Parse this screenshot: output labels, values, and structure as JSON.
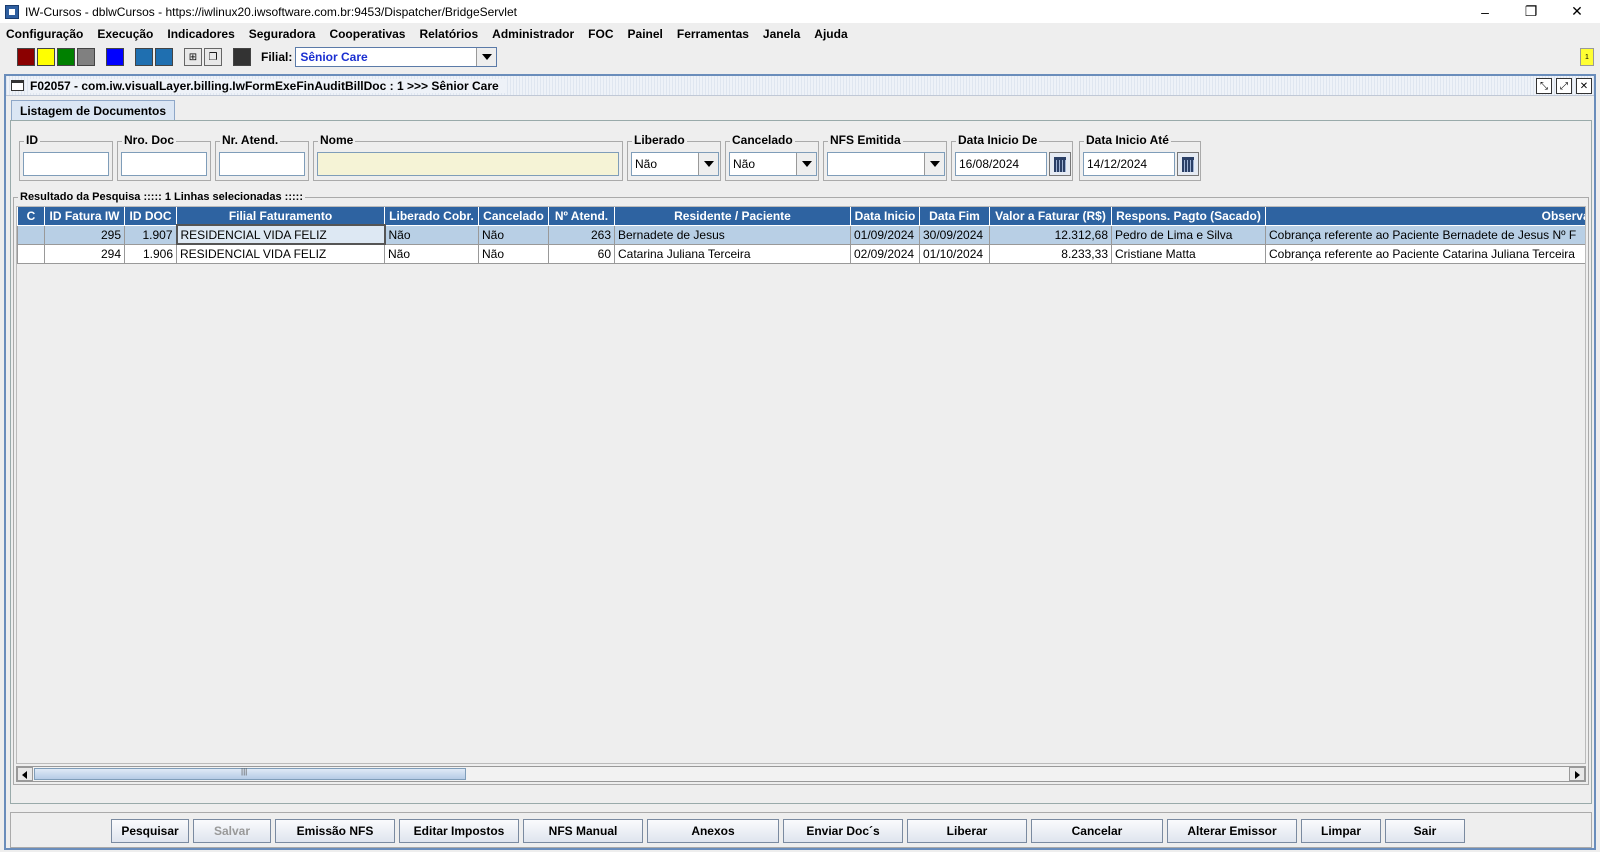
{
  "window": {
    "title": "IW-Cursos - dblwCursos - https://iwlinux20.iwsoftware.com.br:9453/Dispatcher/BridgeServlet",
    "min": "–",
    "restore": "❐",
    "close": "✕"
  },
  "menu": [
    "Configuração",
    "Execução",
    "Indicadores",
    "Seguradora",
    "Cooperativas",
    "Relatórios",
    "Administrador",
    "FOC",
    "Painel",
    "Ferramentas",
    "Janela",
    "Ajuda"
  ],
  "toolbar": {
    "swatches": [
      "#8b0000",
      "#ffff00",
      "#008000",
      "#808080",
      "#0000ff",
      "#1f6fb0",
      "#1f6fb0"
    ],
    "filial_label": "Filial:",
    "filial_value": "Sênior Care",
    "notif": "1"
  },
  "frame": {
    "title": "F02057 - com.iw.visualLayer.billing.IwFormExeFinAuditBillDoc : 1 >>> Sênior Care",
    "tab": "Listagem de Documentos"
  },
  "filters": {
    "id_label": "ID",
    "nrodoc_label": "Nro. Doc",
    "nratend_label": "Nr. Atend.",
    "nome_label": "Nome",
    "liberado_label": "Liberado",
    "liberado_value": "Não",
    "cancelado_label": "Cancelado",
    "cancelado_value": "Não",
    "nfs_label": "NFS Emitida",
    "nfs_value": "",
    "dtde_label": "Data Inicio De",
    "dtde_value": "16/08/2024",
    "dtate_label": "Data Inicio Até",
    "dtate_value": "14/12/2024"
  },
  "results": {
    "label": "Resultado da Pesquisa ::::: 1 Linhas selecionadas :::::",
    "columns": [
      "C",
      "ID Fatura IW",
      "ID DOC",
      "Filial Faturamento",
      "Liberado Cobr.",
      "Cancelado",
      "Nº Atend.",
      "Residente / Paciente",
      "Data Inicio",
      "Data Fim",
      "Valor a Faturar (R$)",
      "Respons. Pagto (Sacado)",
      "Observações"
    ],
    "rows": [
      [
        "",
        "295",
        "1.907",
        "RESIDENCIAL VIDA FELIZ",
        "Não",
        "Não",
        "263",
        "Bernadete de Jesus",
        "01/09/2024",
        "30/09/2024",
        "12.312,68",
        "Pedro de Lima e Silva",
        "Cobrança referente ao Paciente Bernadete de Jesus  Nº F"
      ],
      [
        "",
        "294",
        "1.906",
        "RESIDENCIAL VIDA FELIZ",
        "Não",
        "Não",
        "60",
        "Catarina Juliana Terceira",
        "02/09/2024",
        "01/10/2024",
        "8.233,33",
        "Cristiane Matta",
        "Cobrança referente ao Paciente Catarina Juliana Terceira"
      ]
    ]
  },
  "buttons": {
    "pesquisar": "Pesquisar",
    "salvar": "Salvar",
    "emissao_nfs": "Emissão NFS",
    "editar_impostos": "Editar Impostos",
    "nfs_manual": "NFS Manual",
    "anexos": "Anexos",
    "enviar_docs": "Enviar Doc´s",
    "liberar": "Liberar",
    "cancelar": "Cancelar",
    "alterar_emissor": "Alterar Emissor",
    "limpar": "Limpar",
    "sair": "Sair"
  }
}
